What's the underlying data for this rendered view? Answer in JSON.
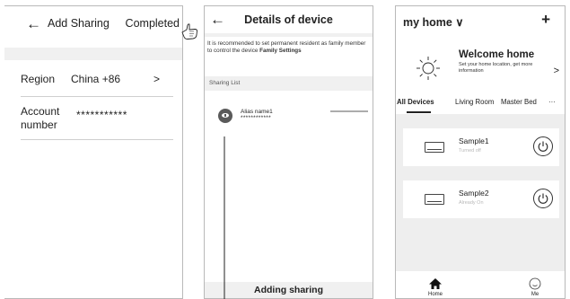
{
  "screen1": {
    "back_glyph": "←",
    "title": "Add Sharing",
    "completed": "Completed",
    "region_label": "Region",
    "region_value": "China +86",
    "region_chevron": ">",
    "account_label": "Account number",
    "account_value": "***********"
  },
  "screen2": {
    "back_glyph": "←",
    "title": "Details of device",
    "note_text": "It is recommended to set permanent resident as family member to control the device ",
    "note_bold": "Family Settings",
    "sharing_list": "Sharing List",
    "alias_name": "Alias name1",
    "alias_account": "************",
    "footer": "Adding sharing"
  },
  "screen3": {
    "home_label": "my home ∨",
    "plus": "+",
    "welcome_title": "Welcome home",
    "welcome_sub": "Set your home location, get more information",
    "welcome_chevron": ">",
    "tabs": [
      "All Devices",
      "Living Room",
      "Master Bed",
      "···"
    ],
    "devices": [
      {
        "name": "Sample1",
        "status": "Turned off"
      },
      {
        "name": "Sample2",
        "status": "Already On"
      }
    ],
    "nav": {
      "home": "Home",
      "me": "Me"
    }
  },
  "icons": [
    "back-arrow-icon",
    "hand-pointer-icon",
    "user-avatar-icon",
    "sun-icon",
    "air-conditioner-icon",
    "power-icon",
    "home-icon",
    "me-icon"
  ],
  "colors": {
    "band": "#f0f0f0",
    "device_bg": "#eeeeee",
    "status_gray": "#b8b8b8",
    "border": "#b9b9b9"
  }
}
